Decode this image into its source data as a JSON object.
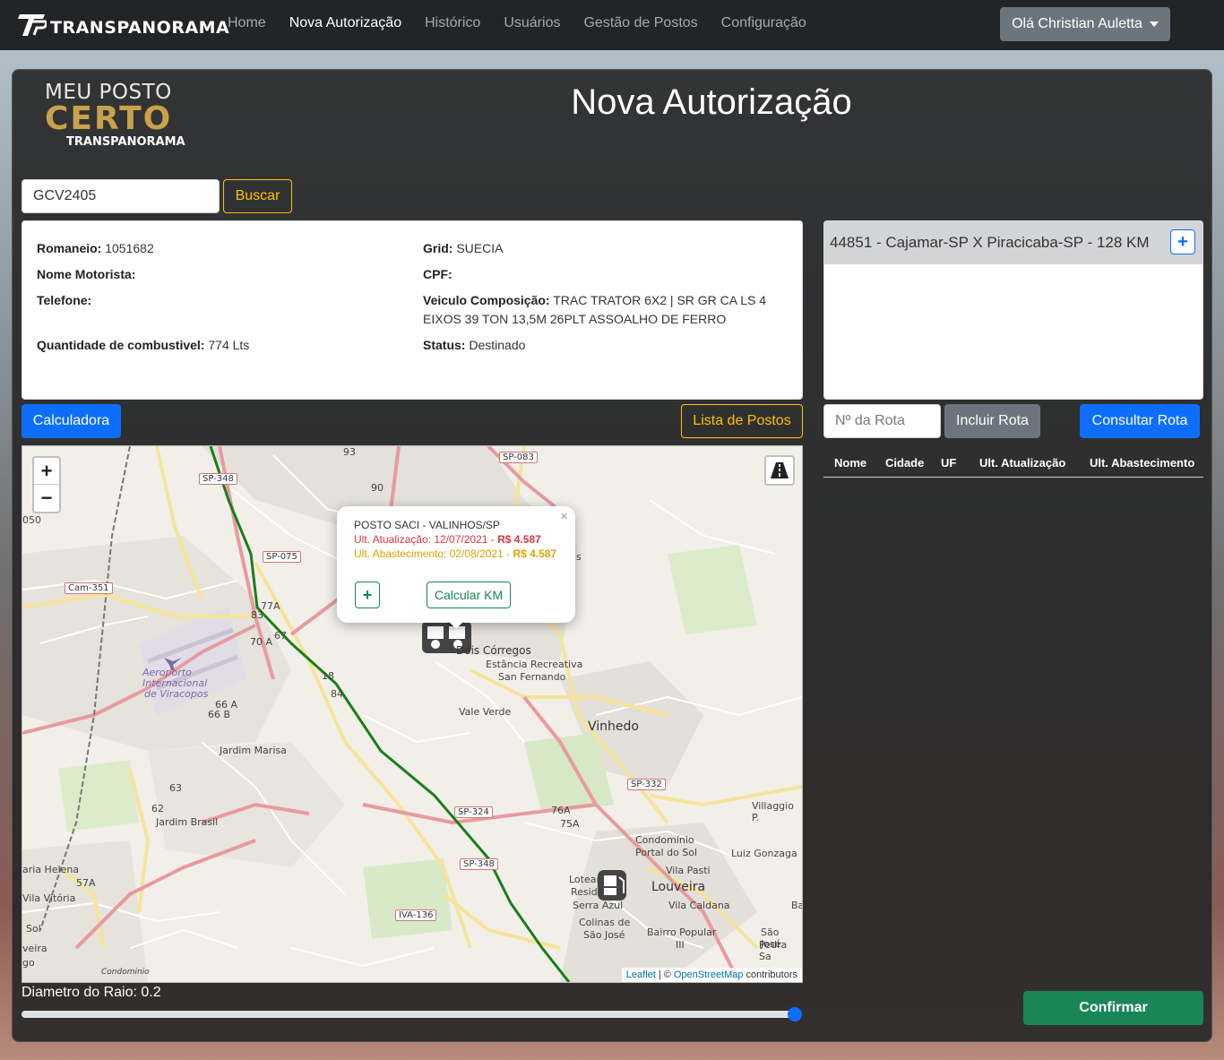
{
  "navbar": {
    "brand": "TRANSPANORAMA",
    "links": [
      "Home",
      "Nova Autorização",
      "Histórico",
      "Usuários",
      "Gestão de Postos",
      "Configuração"
    ],
    "active_index": 1,
    "user_menu": "Olá Christian Auletta"
  },
  "logo": {
    "line1": "MEU POSTO",
    "line2": "CERTO",
    "line3": "TRANSPANORAMA"
  },
  "page_title": "Nova Autorização",
  "search": {
    "value": "GCV2405",
    "button": "Buscar"
  },
  "details": {
    "romaneio_label": "Romaneio:",
    "romaneio": "1051682",
    "motorista_label": "Nome Motorista:",
    "motorista": "",
    "telefone_label": "Telefone:",
    "telefone": "",
    "combustivel_label": "Quantidade de combustivel:",
    "combustivel": "774 Lts",
    "grid_label": "Grid:",
    "grid": "SUECIA",
    "cpf_label": "CPF:",
    "cpf": "",
    "veiculo_label": "Veiculo Composição:",
    "veiculo_line1": "TRAC TRATOR 6X2 | SR GR CA LS 4",
    "veiculo_line2": "EIXOS 39 TON 13,5M 26PLT ASSOALHO DE FERRO",
    "status_label": "Status:",
    "status": "Destinado"
  },
  "routes": {
    "items": [
      "44851 - Cajamar-SP X Piracicaba-SP - 128 KM"
    ],
    "add_symbol": "+"
  },
  "buttons": {
    "calculadora": "Calculadora",
    "lista_postos": "Lista de Postos",
    "rota_placeholder": "Nº da Rota",
    "incluir_rota": "Incluir Rota",
    "consultar_rota": "Consultar Rota",
    "confirmar": "Confirmar"
  },
  "table": {
    "columns": [
      "Nome",
      "Cidade",
      "UF",
      "Ult. Atualização",
      "Ult. Abastecimento"
    ]
  },
  "map": {
    "zoom_in": "+",
    "zoom_out": "−",
    "popup": {
      "title": "POSTO SACI - VALINHOS/SP",
      "atualizacao_prefix": "Ult. Atualização: 12/07/2021 - ",
      "atualizacao_price": "R$ 4.587",
      "abastecimento_prefix": "Ult. Abastecimento: 02/08/2021 - ",
      "abastecimento_price": "R$ 4.587",
      "plus": "+",
      "calcular_km": "Calcular KM",
      "close": "×"
    },
    "attribution": {
      "leaflet": "Leaflet",
      "sep": "| ©",
      "osm": "OpenStreetMap",
      "contrib": "contributors"
    },
    "labels": {
      "aeroporto1": "Aeroporto",
      "aeroporto2": "Internacional",
      "aeroporto3": "de Viracopos",
      "dois_corregos": "Dois Córregos",
      "estancia1": "Estância Recreativa",
      "estancia2": "San Fernando",
      "vale_verde": "Vale Verde",
      "vinhedo": "Vinhedo",
      "jardim_marisa": "Jardim Marisa",
      "jardim_brasil": "Jardim Brasil",
      "villaggio": "Villaggio P.",
      "condominio1": "Condomínio",
      "condominio2": "Portal do Sol",
      "luiz_gonzaga": "Luiz Gonzaga",
      "vila_pasti": "Vila Pasti",
      "louveira": "Louveira",
      "lotear": "Lotear",
      "reside": "Reside",
      "serra_azul": "Serra Azul",
      "vila_caldana": "Vila Caldana",
      "colinas1": "Colinas de",
      "colinas2": "São José",
      "bairro1": "Bairro Popular",
      "bairro2": "III",
      "sao_jose1": "São José",
      "sao_jose2": "Pedra Sa",
      "maria_helena": "aria Helena",
      "vila_vitoria": "Vila Vitória",
      "sol": "Sol",
      "veira": "veira",
      "go": "go",
      "condominio3": "Condominio",
      "sp083": "SP-083",
      "sp348": "SP-348",
      "sp075": "SP-075",
      "cam351": "Cam-351",
      "sp332": "SP-332",
      "sp324": "SP-324",
      "sp348b": "SP-348",
      "iva136": "IVA-136",
      "n050": "050",
      "n93": "93",
      "n90": "90",
      "n77a": "77A",
      "n70a": "70 A",
      "n66a": "66 A",
      "n66b": "66 B",
      "n63": "63",
      "n62": "62",
      "n57a": "57A",
      "n76a": "76A",
      "n75a": "75A",
      "n18": "18",
      "n84": "84",
      "n83": "83",
      "n67": "67",
      "ns": "s",
      "ba": "Ba"
    }
  },
  "raio": {
    "label": "Diametro do Raio: 0.2",
    "value": 1.0
  },
  "colors": {
    "primary": "#0d6efd",
    "warning": "#ffc107",
    "success": "#198754",
    "secondary": "#6c757d",
    "route": "#1a7f1a"
  }
}
